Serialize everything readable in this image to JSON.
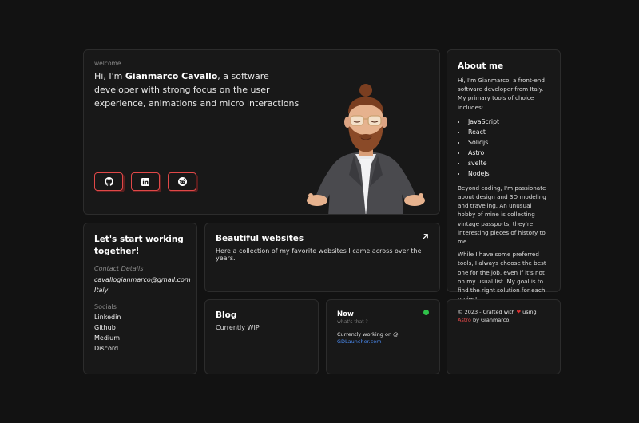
{
  "hero": {
    "welcome": "welcome",
    "intro_prefix": "Hi, I'm ",
    "name": "Gianmarco Cavallo",
    "intro_suffix": ", a software developer with strong focus on the user experience, animations and micro interactions",
    "socials": [
      {
        "icon": "github-icon"
      },
      {
        "icon": "linkedin-icon"
      },
      {
        "icon": "reddit-icon"
      }
    ]
  },
  "about": {
    "title": "About me",
    "intro": "Hi, I'm Gianmarco, a front-end software developer from Italy. My primary tools of choice includes:",
    "tools": [
      "JavaScript",
      "React",
      "Solidjs",
      "Astro",
      "svelte",
      "Nodejs"
    ],
    "p1": "Beyond coding, I'm passionate about design and 3D modeling and traveling. An unusual hobby of mine is collecting vintage passports, they're interesting pieces of history to me.",
    "p2": "While I have some preferred tools, I always choose the best one for the job, even if it's not on my usual list. My goal is to find the right solution for each project."
  },
  "contact": {
    "title": "Let's start working together!",
    "details_label": "Contact Details",
    "email": "cavallogianmarco@gmail.com",
    "country": "Italy",
    "socials_label": "Socials",
    "links": [
      "Linkedin",
      "Github",
      "Medium",
      "Discord"
    ]
  },
  "websites": {
    "title": "Beautiful websites",
    "description": "Here a collection of my favorite websites I came across over the years."
  },
  "blog": {
    "title": "Blog",
    "status": "Currently WIP"
  },
  "now": {
    "title": "Now",
    "subtitle": "what's that ?",
    "line": "Currently working on @",
    "link": "GDLauncher.com"
  },
  "footer": {
    "prefix": "© 2023 - Crafted with ",
    "heart": "❤",
    "middle": " using ",
    "astro": "Astro",
    "suffix": " by Gianmarco."
  },
  "colors": {
    "background": "#121212",
    "card": "#181818",
    "accent_red": "#e04848",
    "status_green": "#2fc24a",
    "link_blue": "#4a8af0"
  }
}
